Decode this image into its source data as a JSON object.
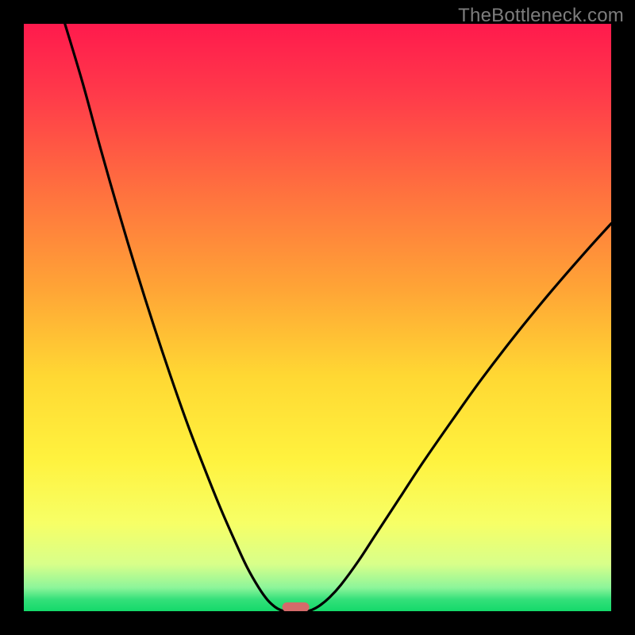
{
  "watermark": "TheBottleneck.com",
  "chart_data": {
    "type": "line",
    "title": "",
    "xlabel": "",
    "ylabel": "",
    "xlim": [
      0,
      100
    ],
    "ylim": [
      0,
      100
    ],
    "series": [
      {
        "name": "curve-left",
        "x": [
          7,
          10,
          13,
          16,
          19,
          22,
          25,
          28,
          31,
          33.5,
          36,
          38,
          40,
          41.5,
          42.8,
          43.8,
          44.5
        ],
        "y": [
          100,
          90,
          79,
          68.5,
          58.5,
          49,
          40,
          31.5,
          23.7,
          17.5,
          11.8,
          7.5,
          4.0,
          1.9,
          0.7,
          0.15,
          0
        ]
      },
      {
        "name": "curve-right",
        "x": [
          48.2,
          49,
          50.3,
          52,
          54,
          57,
          60,
          64,
          68,
          73,
          78,
          84,
          90,
          96,
          100
        ],
        "y": [
          0,
          0.2,
          0.9,
          2.3,
          4.5,
          8.6,
          13.2,
          19.3,
          25.4,
          32.6,
          39.6,
          47.4,
          54.7,
          61.6,
          66
        ]
      }
    ],
    "marker": {
      "name": "indicator",
      "x_start": 44.0,
      "x_end": 48.6,
      "y": 0.7,
      "color": "#d46a6a"
    },
    "gradient_stops": [
      {
        "pct": 0,
        "color": "#ff1a4d"
      },
      {
        "pct": 12,
        "color": "#ff3a4a"
      },
      {
        "pct": 28,
        "color": "#ff6f3f"
      },
      {
        "pct": 45,
        "color": "#ffa436"
      },
      {
        "pct": 60,
        "color": "#ffd833"
      },
      {
        "pct": 74,
        "color": "#fff23e"
      },
      {
        "pct": 85,
        "color": "#f7ff66"
      },
      {
        "pct": 92,
        "color": "#d8ff8a"
      },
      {
        "pct": 96,
        "color": "#8cf59a"
      },
      {
        "pct": 98,
        "color": "#34e07a"
      },
      {
        "pct": 100,
        "color": "#14d96a"
      }
    ]
  }
}
